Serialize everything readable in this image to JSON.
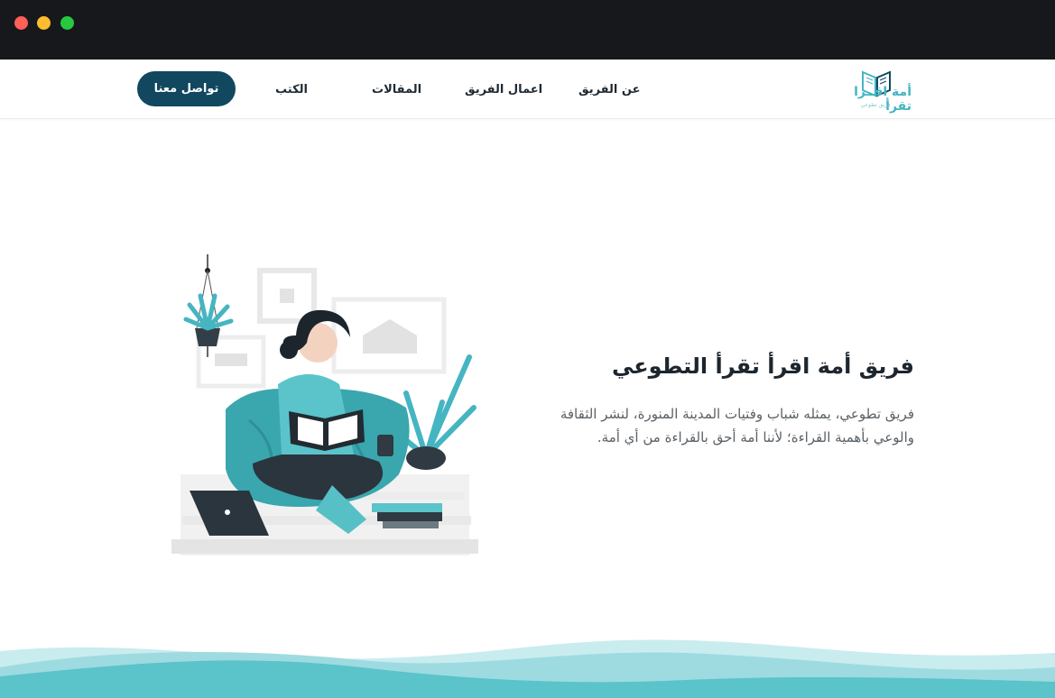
{
  "window": {
    "controls": [
      "close",
      "minimize",
      "maximize"
    ]
  },
  "brand": {
    "name": "أمة اقرأ تقرأ",
    "logo_title": "أمة اقــرا تقرأ",
    "logo_sub": "فريق تطوعي",
    "accent": "#45b5c2",
    "primary": "#11485f"
  },
  "nav": {
    "items": [
      {
        "label": "عن الفريق"
      },
      {
        "label": "اعمال الفريق"
      },
      {
        "label": "المقالات"
      },
      {
        "label": "الكتب"
      }
    ],
    "cta_label": "تواصل معنا"
  },
  "hero": {
    "title": "فريق أمة اقرأ تقرأ التطوعي",
    "description": "فريق تطوعي، يمثله شباب وفتيات المدينة المنورة، لنشر الثقافة والوعي بأهمية القراءة؛ لأننا أمة أحق بالقراءة من أي أمة.",
    "illustration": "woman-reading-book-illustration"
  },
  "footer": {
    "decoration": "teal-wave",
    "colors": [
      "#5bc3ca",
      "#9ddbe0",
      "#c9ecef"
    ]
  }
}
